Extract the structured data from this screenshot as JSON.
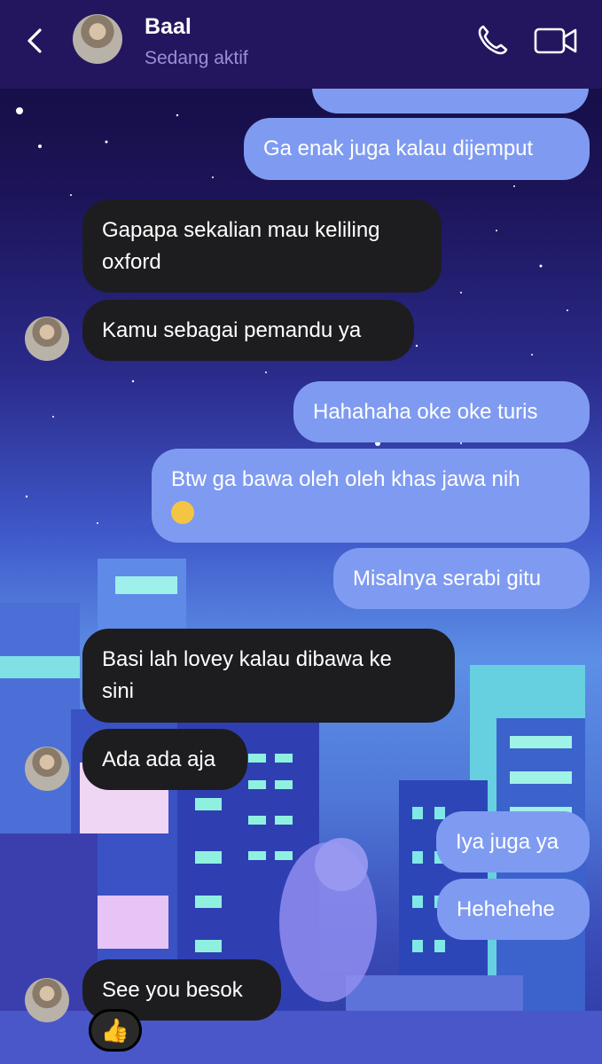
{
  "header": {
    "contact_name": "Baal",
    "status": "Sedang aktif"
  },
  "messages": [
    {
      "sender": "me",
      "text": "Ga enak juga kalau dijemput"
    },
    {
      "sender": "them",
      "text": "Gapapa sekalian mau keliling oxford"
    },
    {
      "sender": "them",
      "text": "Kamu sebagai pemandu ya"
    },
    {
      "sender": "me",
      "text": "Hahahaha oke oke turis"
    },
    {
      "sender": "me",
      "text": "Btw ga bawa oleh oleh khas jawa nih"
    },
    {
      "sender": "me",
      "text": "Misalnya serabi gitu"
    },
    {
      "sender": "them",
      "text": "Basi lah lovey kalau dibawa ke sini"
    },
    {
      "sender": "them",
      "text": "Ada ada aja"
    },
    {
      "sender": "me",
      "text": "Iya juga ya"
    },
    {
      "sender": "me",
      "text": "Hehehehe"
    },
    {
      "sender": "them",
      "text": "See you besok",
      "reaction": "👍"
    }
  ]
}
